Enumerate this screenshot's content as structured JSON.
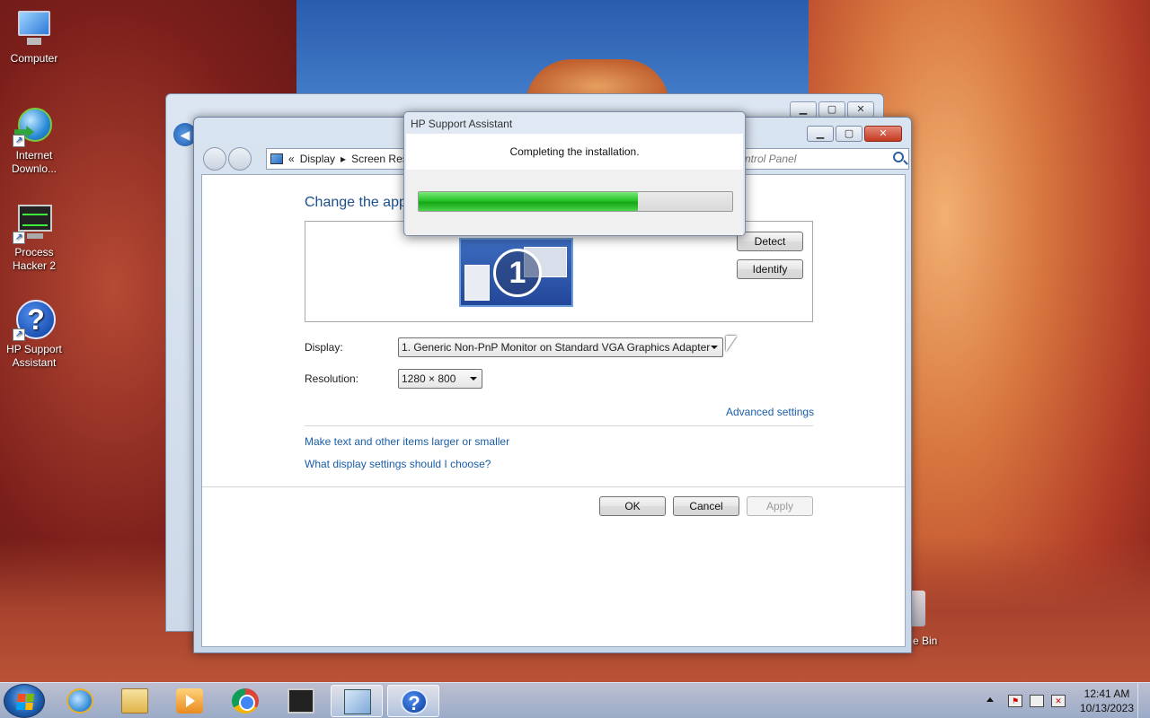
{
  "desktop": {
    "icons": [
      {
        "label": "Computer"
      },
      {
        "label": "Internet Downlo..."
      },
      {
        "label": "Process Hacker 2"
      },
      {
        "label": "HP Support Assistant"
      }
    ],
    "recycle_bin_partial_label": "e Bin"
  },
  "window": {
    "caption_buttons": {
      "minimize": "▁",
      "maximize": "▢",
      "close": "✕"
    },
    "address": {
      "chevrons": "«",
      "crumb1": "Display",
      "sep": "▸",
      "crumb2": "Screen Res"
    },
    "search_placeholder": "ntrol Panel",
    "heading": "Change the appe",
    "monitor_number": "1",
    "detect_button": "Detect",
    "identify_button": "Identify",
    "display_label": "Display:",
    "display_value": "1. Generic Non-PnP Monitor on Standard VGA Graphics Adapter",
    "resolution_label": "Resolution:",
    "resolution_value": "1280 × 800",
    "advanced_link": "Advanced settings",
    "link_text_size": "Make text and other items larger or smaller",
    "link_choose": "What display settings should I choose?",
    "ok_button": "OK",
    "cancel_button": "Cancel",
    "apply_button": "Apply"
  },
  "dialog": {
    "title": "HP Support Assistant",
    "message": "Completing the installation.",
    "progress_fraction": 0.7,
    "progress_color": "#28c428"
  },
  "taskbar": {
    "pinned": [
      "internet-explorer-icon",
      "folder-icon",
      "media-player-icon",
      "chrome-icon",
      "process-hacker-icon",
      "control-panel-icon",
      "hp-support-icon"
    ],
    "active": "control-panel-icon",
    "clock_time": "12:41 AM",
    "clock_date": "10/13/2023",
    "hp_glyph": "?",
    "tray_flag": "⚑",
    "tray_sound_mute": "✕"
  }
}
